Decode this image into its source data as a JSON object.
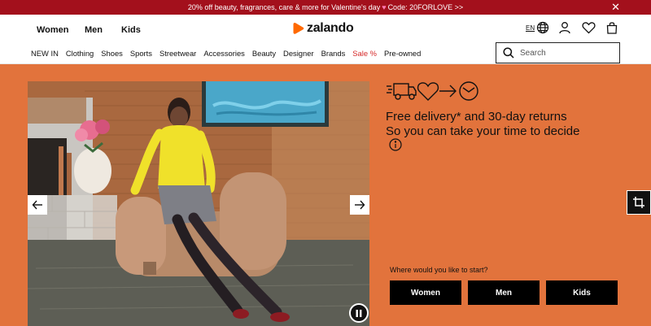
{
  "promo": {
    "text_before": "20% off beauty, fragrances, care & more for Valentine's day",
    "heart": "♥",
    "text_after": "Code: 20FORLOVE >>",
    "close": "✕"
  },
  "header": {
    "genders": [
      "Women",
      "Men",
      "Kids"
    ],
    "logo_text": "zalando",
    "language": "EN"
  },
  "nav": {
    "items": [
      "NEW IN",
      "Clothing",
      "Shoes",
      "Sports",
      "Streetwear",
      "Accessories",
      "Beauty",
      "Designer",
      "Brands",
      "Sale %",
      "Pre-owned"
    ]
  },
  "search": {
    "placeholder": "Search"
  },
  "delivery": {
    "line1": "Free delivery* and 30-day returns",
    "line2": "So you can take your time to decide"
  },
  "start": {
    "label": "Where would you like to start?",
    "buttons": [
      "Women",
      "Men",
      "Kids"
    ]
  },
  "colors": {
    "brand_orange": "#ff6900",
    "page_background": "#e2733c",
    "promo_bar": "#a3101c"
  }
}
